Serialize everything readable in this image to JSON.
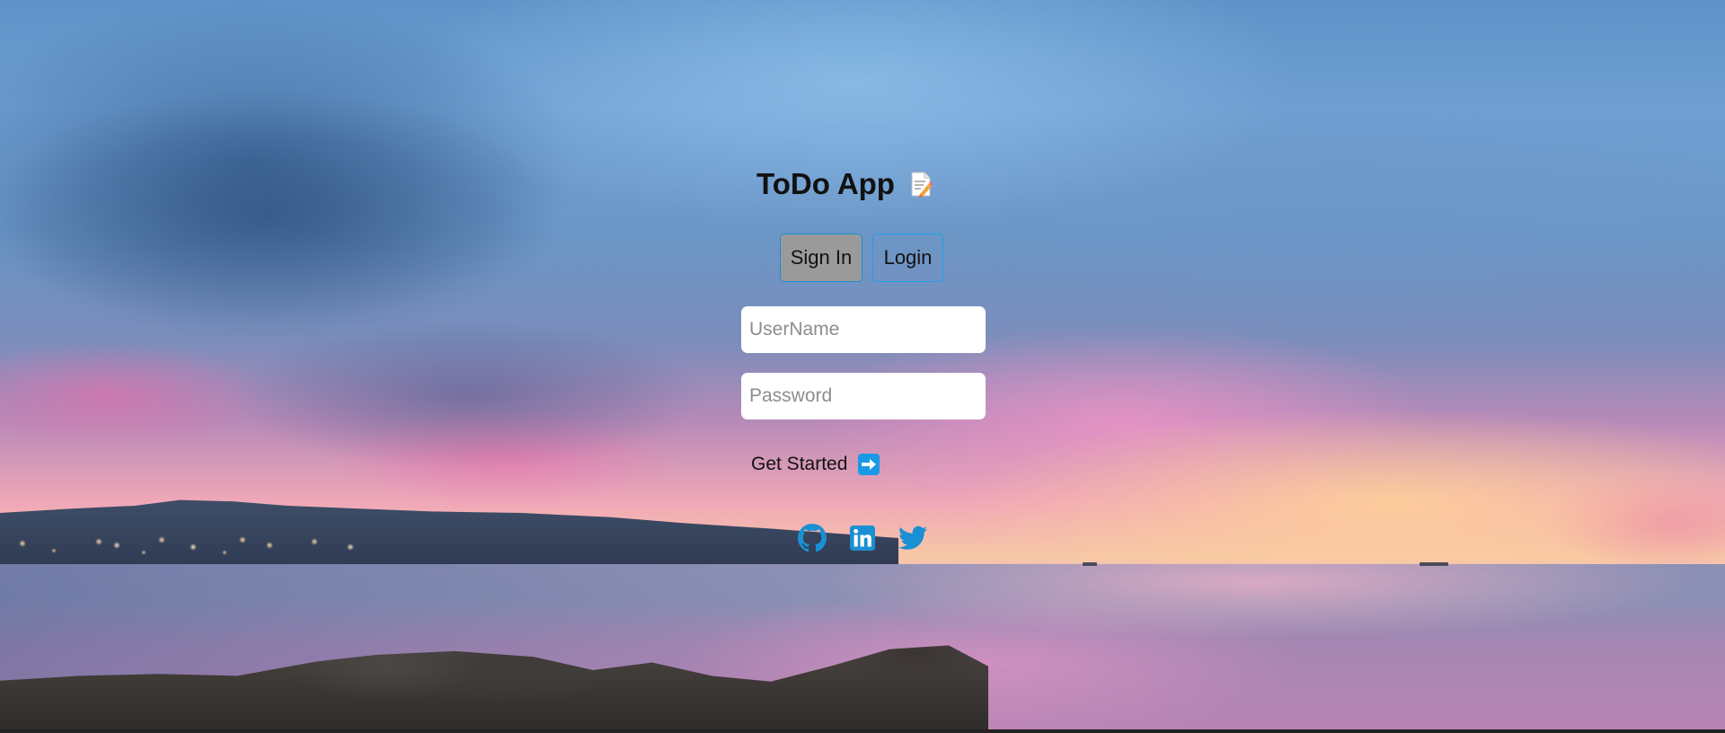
{
  "app": {
    "title": "ToDo App",
    "title_icon": "memo-icon"
  },
  "tabs": [
    {
      "label": "Sign In",
      "active": true
    },
    {
      "label": "Login",
      "active": false
    }
  ],
  "form": {
    "username": {
      "placeholder": "UserName",
      "value": ""
    },
    "password": {
      "placeholder": "Password",
      "value": ""
    },
    "submit_label": "Get Started",
    "submit_icon": "right-arrow-icon"
  },
  "socials": [
    {
      "name": "github-icon"
    },
    {
      "name": "linkedin-icon"
    },
    {
      "name": "twitter-icon"
    }
  ],
  "colors": {
    "accent": "#1da0e8",
    "active_tab_bg": "#9a9a9a",
    "social_icon": "#1a8fd4"
  }
}
